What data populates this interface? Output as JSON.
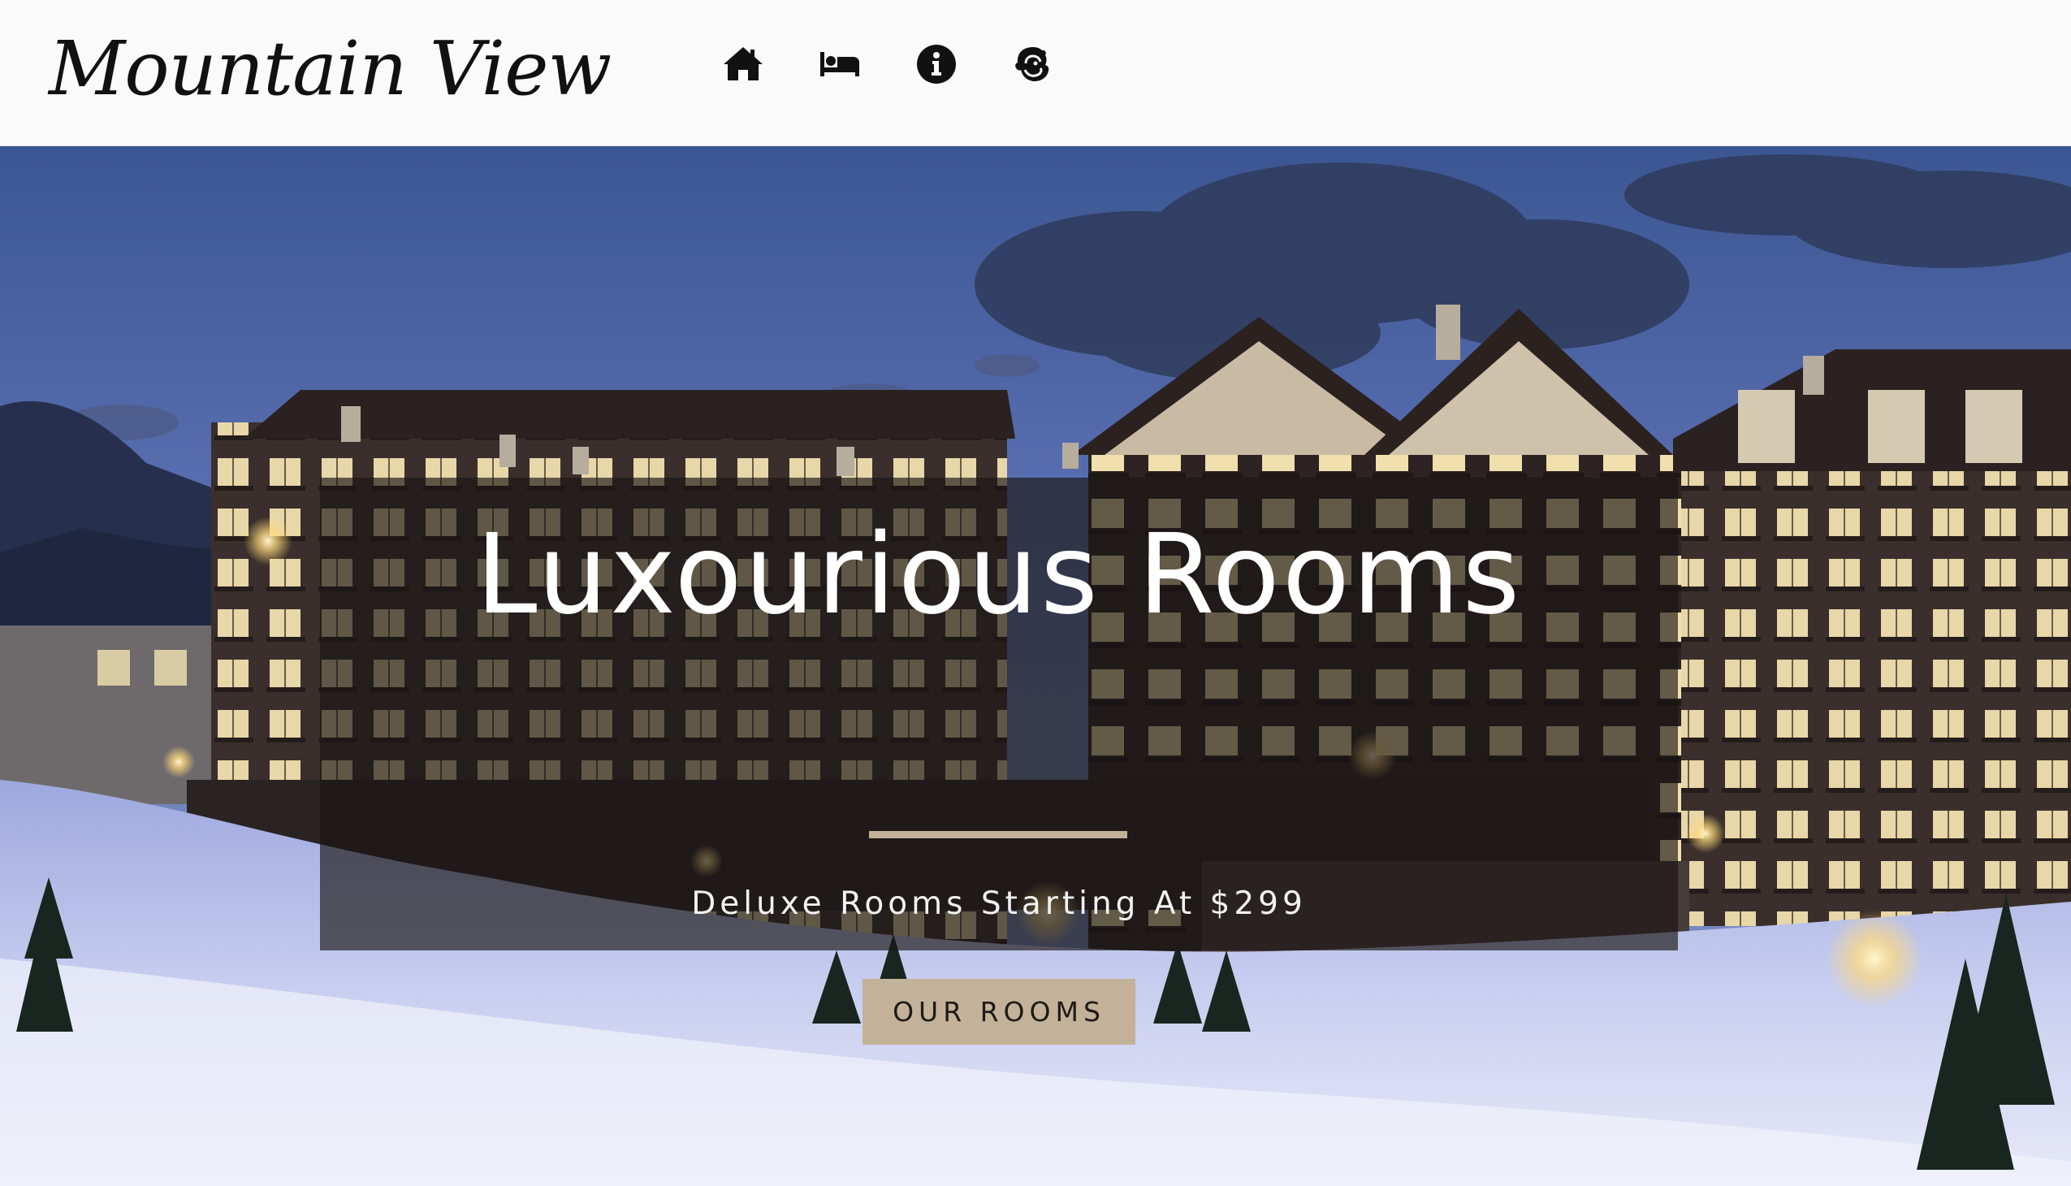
{
  "navbar": {
    "brand": "Mountain View",
    "icons": [
      {
        "name": "home-icon"
      },
      {
        "name": "bed-icon"
      },
      {
        "name": "info-icon"
      },
      {
        "name": "mailchimp-icon"
      }
    ]
  },
  "hero": {
    "title": "Luxourious Rooms",
    "subtitle": "Deluxe Rooms Starting At $299",
    "button_label": "OUR ROOMS"
  },
  "colors": {
    "accent": "#c3b299",
    "navbar_bg": "#fafafa",
    "overlay": "#1a1614"
  }
}
